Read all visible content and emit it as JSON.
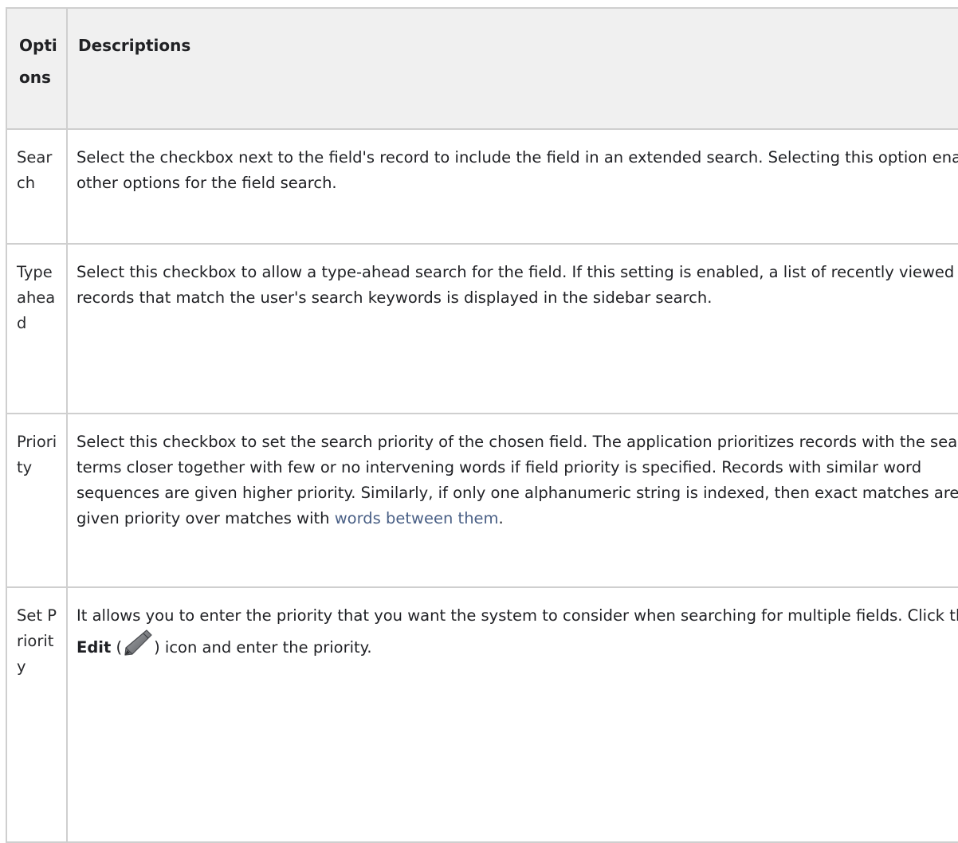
{
  "table": {
    "headers": {
      "options": "Options",
      "descriptions": "Descriptions"
    },
    "rows": [
      {
        "option": "Search",
        "description": "Select the checkbox next to the field's record to include the field in an extended search. Selecting this option enables other options for the field search."
      },
      {
        "option": "Typeahead",
        "description": "Select this checkbox to allow a type-ahead search for the field. If this setting is enabled, a list of recently viewed records that match the user's search keywords is displayed in the sidebar search."
      },
      {
        "option": "Priority",
        "description_prefix": "Select this checkbox to set the search priority of the chosen field. The application prioritizes records with the search terms closer together with few or no intervening words if field priority is specified. Records with similar word sequences are given higher priority. Similarly, if only one alphanumeric string is indexed, then exact matches are given priority over matches with ",
        "description_link": "words between them",
        "description_suffix": "."
      },
      {
        "option": "Set Priority",
        "description_prefix": "It allows you to enter the priority that you want the system to consider when searching for multiple fields. Click the ",
        "description_bold": "Edit",
        "description_paren_open": " (",
        "description_icon": "pencil-icon",
        "description_suffix": ") icon and enter the priority."
      }
    ]
  },
  "colors": {
    "border": "#cfcfcf",
    "header_bg": "#f0f0f0",
    "link": "#4a6086"
  }
}
